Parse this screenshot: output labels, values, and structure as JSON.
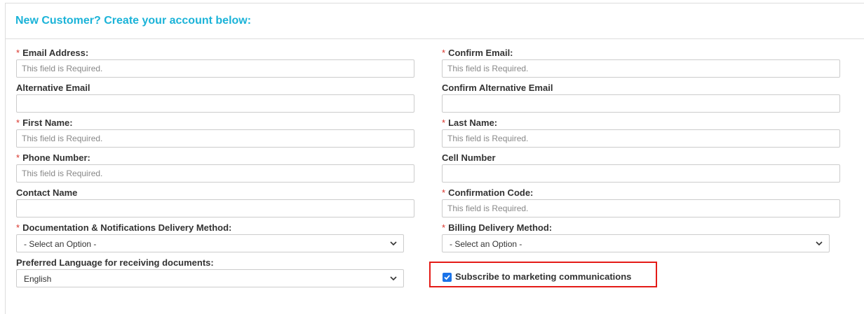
{
  "header": {
    "title": "New Customer? Create your account below:"
  },
  "required_marker": "*",
  "fields": {
    "email": {
      "label": "Email Address:",
      "placeholder": "This field is Required.",
      "value": ""
    },
    "confirm_email": {
      "label": "Confirm Email:",
      "placeholder": "This field is Required.",
      "value": ""
    },
    "alt_email": {
      "label": "Alternative Email",
      "placeholder": "",
      "value": ""
    },
    "confirm_alt_email": {
      "label": "Confirm Alternative Email",
      "placeholder": "",
      "value": ""
    },
    "first_name": {
      "label": "First Name:",
      "placeholder": "This field is Required.",
      "value": ""
    },
    "last_name": {
      "label": "Last Name:",
      "placeholder": "This field is Required.",
      "value": ""
    },
    "phone": {
      "label": "Phone Number:",
      "placeholder": "This field is Required.",
      "value": ""
    },
    "cell": {
      "label": "Cell Number",
      "placeholder": "",
      "value": ""
    },
    "contact_name": {
      "label": "Contact Name",
      "placeholder": "",
      "value": ""
    },
    "confirmation_code": {
      "label": "Confirmation Code:",
      "placeholder": "This field is Required.",
      "value": ""
    }
  },
  "selects": {
    "doc_delivery": {
      "label": "Documentation & Notifications Delivery Method:",
      "value": "- Select an Option -"
    },
    "billing_delivery": {
      "label": "Billing Delivery Method:",
      "value": "- Select an Option -"
    },
    "language": {
      "label": "Preferred Language for receiving documents:",
      "value": "English"
    }
  },
  "marketing": {
    "label": "Subscribe to marketing communications",
    "checked": true
  },
  "colors": {
    "title": "#1bb3d8",
    "required": "#d9342b",
    "highlight": "#e41b17",
    "checkbox": "#1a73e8"
  }
}
